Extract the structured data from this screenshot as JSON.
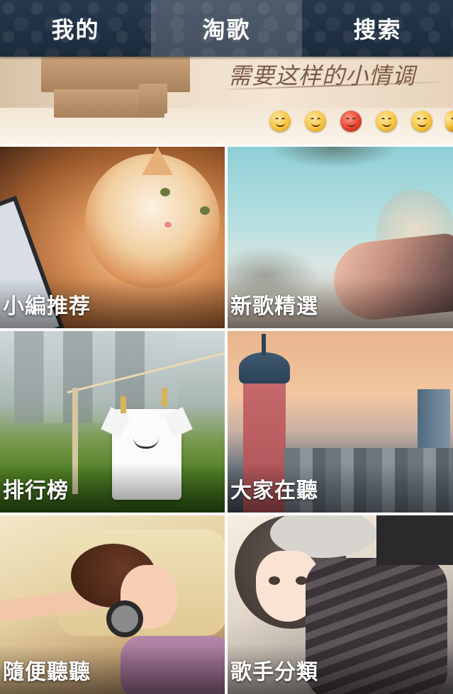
{
  "nav": {
    "tabs": [
      {
        "label": "我的",
        "active": false
      },
      {
        "label": "淘歌",
        "active": true
      },
      {
        "label": "搜索",
        "active": false
      }
    ]
  },
  "banner": {
    "text": "需要这样的小情调",
    "emoji_icons": [
      "smile-tongue-icon",
      "smile-tongue-icon",
      "angry-face-icon",
      "smile-tongue-icon",
      "smile-tongue-icon",
      "smile-tongue-icon"
    ]
  },
  "tiles": [
    {
      "label": "小編推荐",
      "image": "cat-photo"
    },
    {
      "label": "新歌精選",
      "image": "girl-lying-photo"
    },
    {
      "label": "排行榜",
      "image": "tshirt-clothesline-photo"
    },
    {
      "label": "大家在聽",
      "image": "city-tower-photo"
    },
    {
      "label": "隨便聽聽",
      "image": "girl-headphones-photo"
    },
    {
      "label": "歌手分類",
      "image": "anime-girl-photo"
    }
  ],
  "colors": {
    "topbar": "#1f2f42",
    "active_tab_overlay": "rgba(255,255,255,0.18)",
    "label_text": "#ffffff"
  }
}
